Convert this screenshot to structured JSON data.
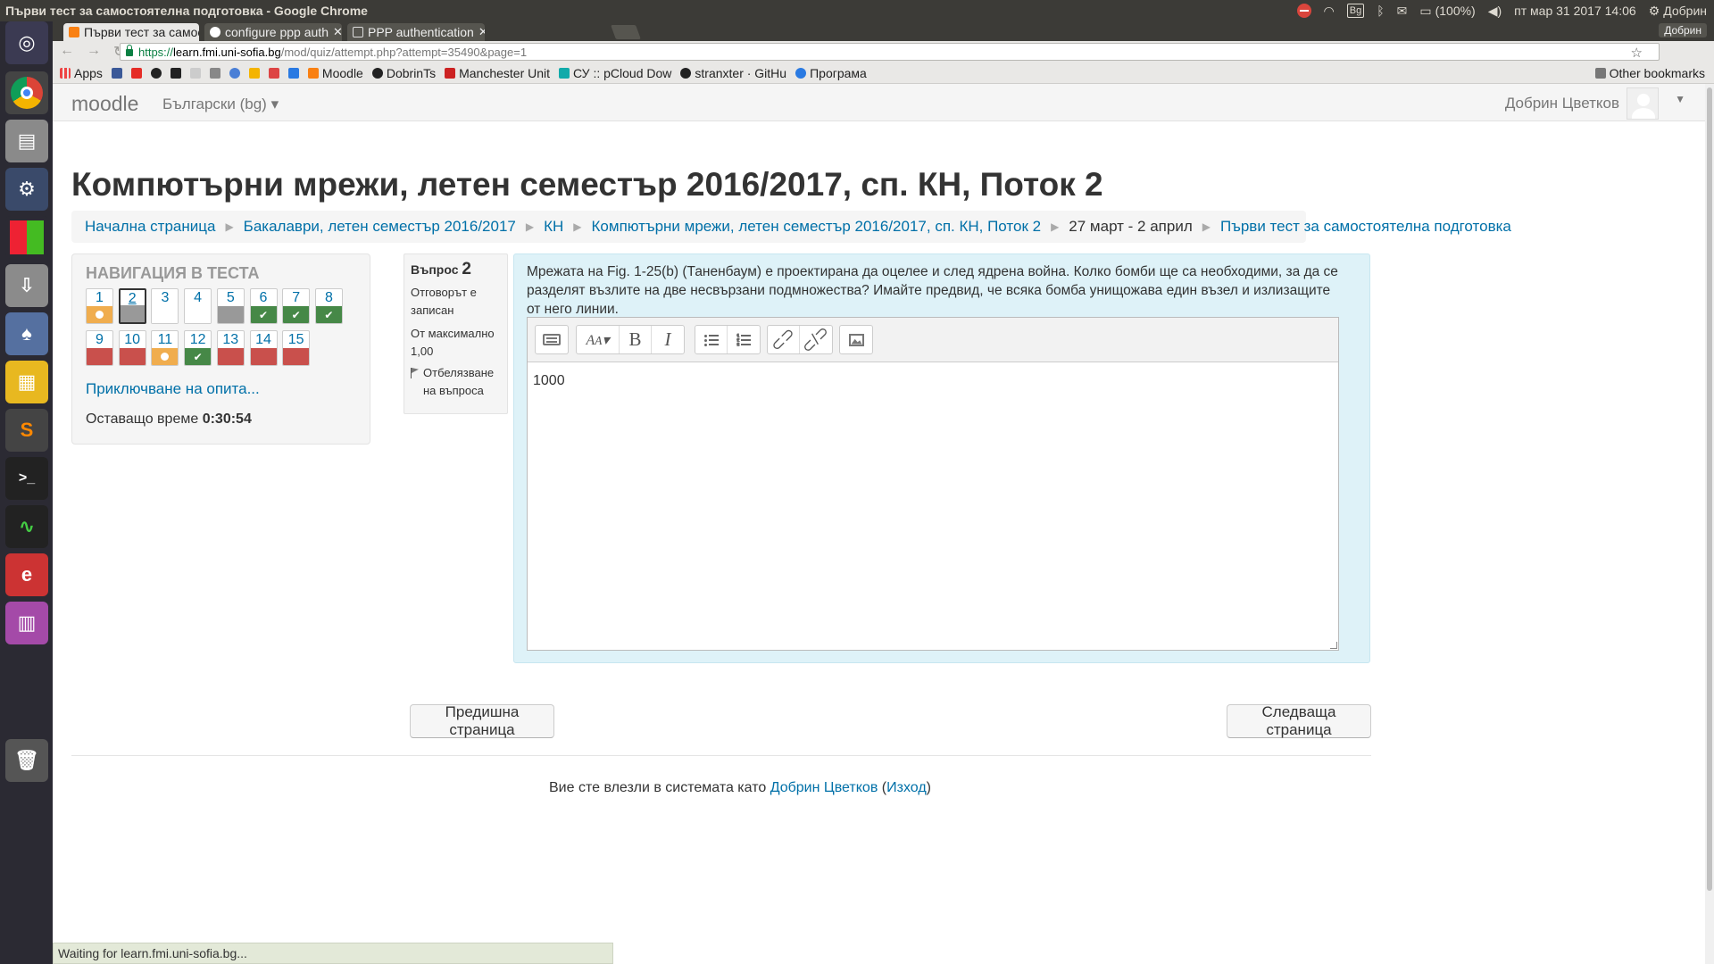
{
  "system": {
    "window_title": "Първи тест за самостоятелна подготовка - Google Chrome",
    "keyboard_layout": "Bg",
    "battery": "(100%)",
    "clock": "пт мар 31 2017 14:06",
    "user": "Добрин"
  },
  "browser": {
    "tabs": [
      {
        "label": "Първи тест за самос",
        "active": true
      },
      {
        "label": "configure ppp auth",
        "active": false
      },
      {
        "label": "PPP authentication",
        "active": false
      }
    ],
    "profile_button": "Добрин",
    "url": {
      "scheme": "https://",
      "host": "learn.fmi.uni-sofia.bg",
      "path": "/mod/quiz/attempt.php?attempt=35490&page=1"
    },
    "bookmarks": [
      "Apps",
      "Moodle",
      "DobrinTs",
      "Manchester Unit",
      "СУ :: pCloud Dow",
      "stranxter · GitHu",
      "Програма"
    ],
    "other_bookmarks": "Other bookmarks",
    "status_text": "Waiting for learn.fmi.uni-sofia.bg..."
  },
  "moodle": {
    "brand": "moodle",
    "language": "Български (bg)",
    "user_name": "Добрин Цветков",
    "course_title": "Компютърни мрежи, летен семестър 2016/2017, сп. КН, Поток 2",
    "breadcrumb": [
      {
        "label": "Начална страница",
        "link": true
      },
      {
        "label": "Бакалаври, летен семестър 2016/2017",
        "link": true
      },
      {
        "label": "КН",
        "link": true
      },
      {
        "label": "Компютърни мрежи, летен семестър 2016/2017, сп. КН, Поток 2",
        "link": true
      },
      {
        "label": "27 март - 2 април",
        "link": false
      },
      {
        "label": "Първи тест за самостоятелна подготовка",
        "link": true
      }
    ],
    "quiz_nav": {
      "title": "Навигация в теста",
      "questions": [
        {
          "n": "1",
          "state": "answered"
        },
        {
          "n": "2",
          "state": "saved",
          "current": true
        },
        {
          "n": "3",
          "state": "none"
        },
        {
          "n": "4",
          "state": "none"
        },
        {
          "n": "5",
          "state": "saved"
        },
        {
          "n": "6",
          "state": "correct"
        },
        {
          "n": "7",
          "state": "correct"
        },
        {
          "n": "8",
          "state": "correct"
        },
        {
          "n": "9",
          "state": "wrong"
        },
        {
          "n": "10",
          "state": "wrong"
        },
        {
          "n": "11",
          "state": "answered"
        },
        {
          "n": "12",
          "state": "correct"
        },
        {
          "n": "13",
          "state": "wrong"
        },
        {
          "n": "14",
          "state": "wrong"
        },
        {
          "n": "15",
          "state": "wrong"
        }
      ],
      "finish_link": "Приключване на опита...",
      "time_label": "Оставащо време",
      "time_value": "0:30:54"
    },
    "question_info": {
      "label": "Въпрос",
      "number": "2",
      "status": "Отговорът е записан",
      "max_label": "От максимално",
      "max_value": "1,00",
      "flag_label": "Отбелязване на въпроса"
    },
    "question": {
      "text": "Мрежата на Fig. 1-25(b) (Таненбаум) е проектирана да оцелее и след ядрена война. Колко бомби ще са необходими, за да се разделят възлите на две несвързани подмножества? Имайте предвид, че всяка бомба унищожава един възел и излизащите от него линии.",
      "answer": "1000"
    },
    "buttons": {
      "prev": "Предишна страница",
      "next": "Следваща страница"
    },
    "login_info": {
      "prefix": "Вие сте влезли в системата като",
      "user": "Добрин Цветков",
      "logout": "Изход"
    }
  },
  "colors": {
    "answered": "#f0ad4e",
    "saved": "#999999",
    "correct": "#468847",
    "wrong": "#c9504c",
    "link": "#0070a8",
    "question_bg": "#def2f8"
  }
}
